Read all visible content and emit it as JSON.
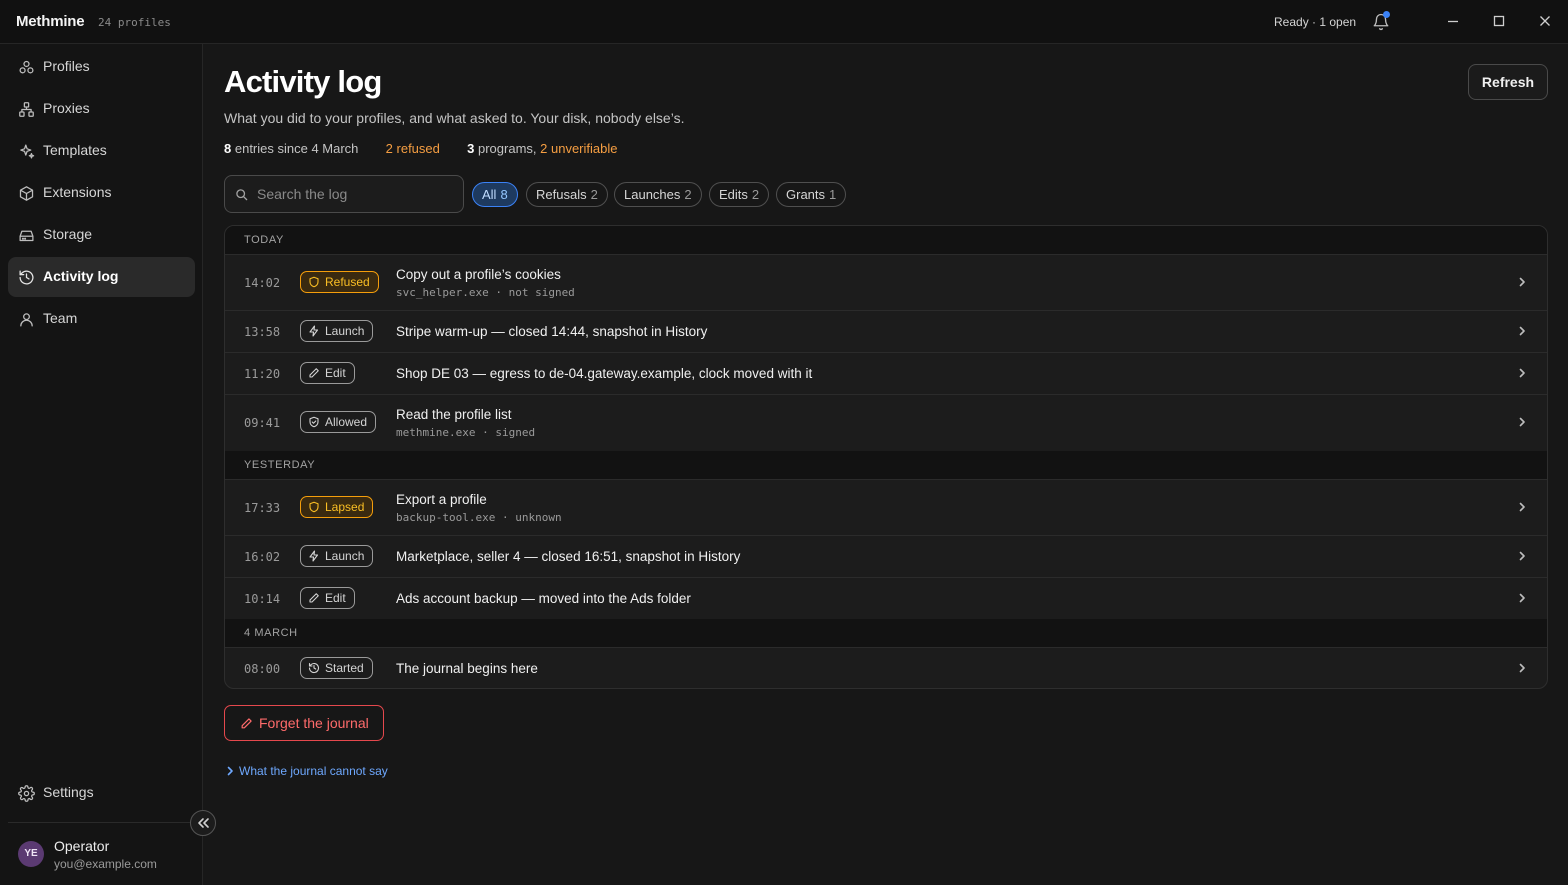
{
  "app": {
    "name": "Methmine",
    "profiles_count": "24 profiles",
    "status": "Ready · 1 open"
  },
  "sidebar": {
    "items": [
      {
        "label": "Profiles",
        "icon": "profiles-icon"
      },
      {
        "label": "Proxies",
        "icon": "proxies-icon"
      },
      {
        "label": "Templates",
        "icon": "templates-icon"
      },
      {
        "label": "Extensions",
        "icon": "extensions-icon"
      },
      {
        "label": "Storage",
        "icon": "storage-icon"
      },
      {
        "label": "Activity log",
        "icon": "activity-log-icon",
        "active": true
      },
      {
        "label": "Team",
        "icon": "team-icon"
      }
    ],
    "settings_label": "Settings",
    "user": {
      "initials": "YE",
      "name": "Operator",
      "email": "you@example.com"
    }
  },
  "page": {
    "title": "Activity log",
    "subtitle": "What you did to your profiles, and what asked to. Your disk, nobody else’s.",
    "refresh_label": "Refresh",
    "stats": {
      "entries_count": "8",
      "entries_text": "entries since 4 March",
      "refused": "2 refused",
      "programs_count": "3",
      "programs_text": "programs,",
      "unverifiable": "2 unverifiable"
    },
    "search_placeholder": "Search the log",
    "filters": [
      {
        "label": "All",
        "count": "8",
        "active": true
      },
      {
        "label": "Refusals",
        "count": "2"
      },
      {
        "label": "Launches",
        "count": "2"
      },
      {
        "label": "Edits",
        "count": "2"
      },
      {
        "label": "Grants",
        "count": "1"
      }
    ],
    "groups": [
      {
        "label": "TODAY"
      },
      {
        "label": "YESTERDAY"
      },
      {
        "label": "4 MARCH"
      }
    ],
    "entries": [
      {
        "time": "14:02",
        "badge": "Refused",
        "title": "Copy out a profile’s cookies",
        "meta": "svc_helper.exe · not signed"
      },
      {
        "time": "13:58",
        "badge": "Launch",
        "title": "Stripe warm-up — closed 14:44, snapshot in History"
      },
      {
        "time": "11:20",
        "badge": "Edit",
        "title": "Shop DE 03 — egress to de-04.gateway.example, clock moved with it"
      },
      {
        "time": "09:41",
        "badge": "Allowed",
        "title": "Read the profile list",
        "meta": "methmine.exe · signed"
      },
      {
        "time": "17:33",
        "badge": "Lapsed",
        "title": "Export a profile",
        "meta": "backup-tool.exe · unknown"
      },
      {
        "time": "16:02",
        "badge": "Launch",
        "title": "Marketplace, seller 4 — closed 16:51, snapshot in History"
      },
      {
        "time": "10:14",
        "badge": "Edit",
        "title": "Ads account backup — moved into the Ads folder"
      },
      {
        "time": "08:00",
        "badge": "Started",
        "title": "The journal begins here"
      }
    ],
    "forget_label": "Forget the journal",
    "disclosure_label": "What the journal cannot say"
  },
  "colors": {
    "accent": "#3b82f6",
    "warning": "#f59e0b",
    "danger": "#e5484d",
    "link": "#6ea8fe"
  }
}
